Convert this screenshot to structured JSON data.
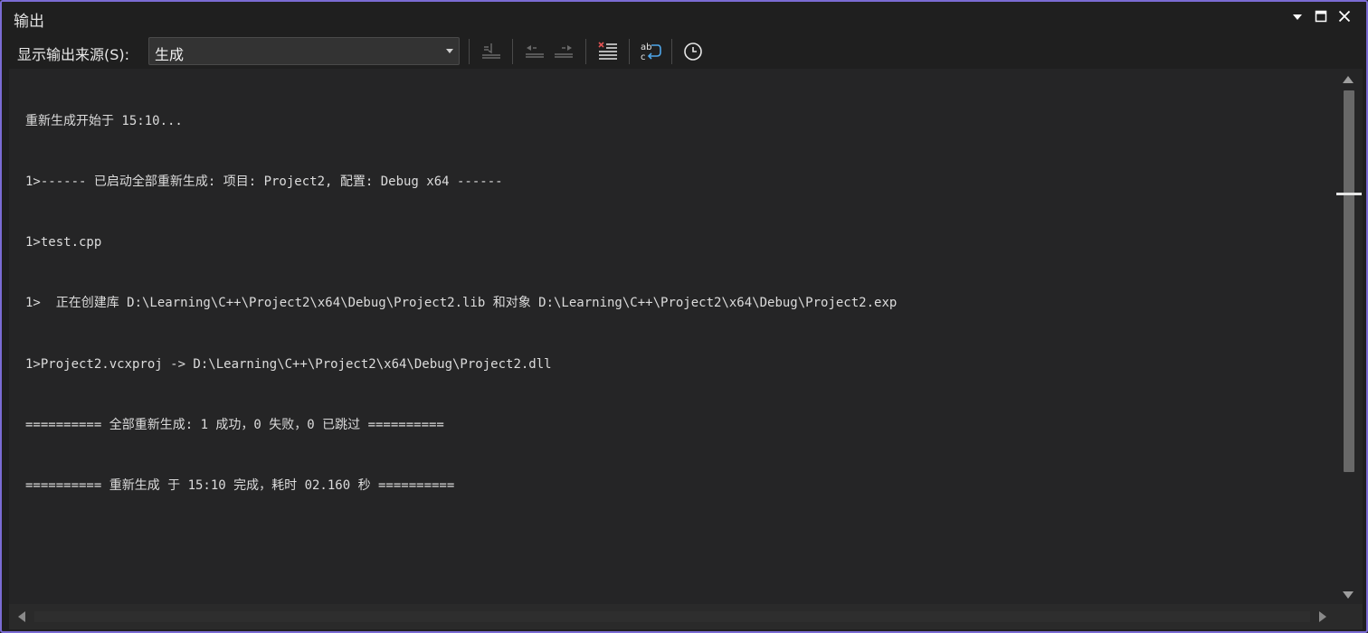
{
  "window": {
    "title": "输出"
  },
  "title_buttons": {
    "dropdown_icon": "chevron-down-icon",
    "maximize_icon": "maximize-icon",
    "close_icon": "close-icon"
  },
  "toolbar": {
    "source_label": "显示输出来源(S):",
    "source_selected": "生成",
    "buttons": [
      {
        "icon": "go-to-line-icon",
        "enabled": false
      },
      {
        "icon": "previous-message-icon",
        "enabled": false
      },
      {
        "icon": "next-message-icon",
        "enabled": false
      },
      {
        "icon": "clear-all-icon",
        "enabled": true
      },
      {
        "icon": "toggle-word-wrap-icon",
        "enabled": true
      },
      {
        "icon": "timestamp-clock-icon",
        "enabled": true
      }
    ]
  },
  "output": {
    "lines": [
      "重新生成开始于 15:10...",
      "1>------ 已启动全部重新生成: 项目: Project2, 配置: Debug x64 ------",
      "1>test.cpp",
      "1>  正在创建库 D:\\Learning\\C++\\Project2\\x64\\Debug\\Project2.lib 和对象 D:\\Learning\\C++\\Project2\\x64\\Debug\\Project2.exp",
      "1>Project2.vcxproj -> D:\\Learning\\C++\\Project2\\x64\\Debug\\Project2.dll",
      "========== 全部重新生成: 1 成功，0 失败，0 已跳过 ==========",
      "========== 重新生成 于 15:10 完成，耗时 02.160 秒 =========="
    ]
  },
  "colors": {
    "accent_border": "#7a6bd3",
    "background": "#1f1f1f",
    "output_background": "#252526",
    "clear_icon_red": "#e05252",
    "wrap_icon_blue": "#4ea6ea"
  }
}
